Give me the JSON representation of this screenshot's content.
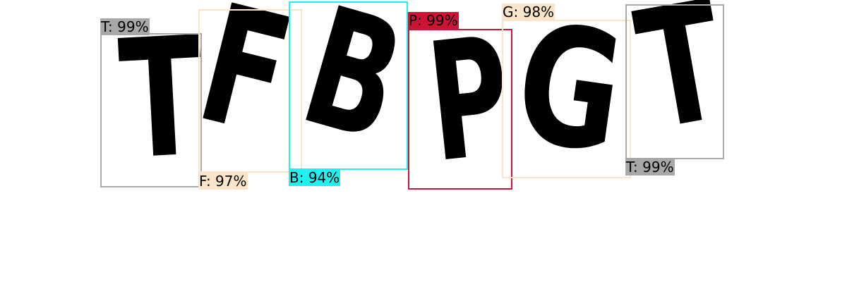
{
  "captcha_letters": [
    "T",
    "F",
    "B",
    "P",
    "G",
    "T"
  ],
  "detections": [
    {
      "label": "T: 99%",
      "char": "T",
      "confidence": 0.99,
      "color": "#a8a8a8"
    },
    {
      "label": "F: 97%",
      "char": "F",
      "confidence": 0.97,
      "color": "#fbe5c8"
    },
    {
      "label": "B: 94%",
      "char": "B",
      "confidence": 0.94,
      "color": "#1ff0f0"
    },
    {
      "label": "P: 99%",
      "char": "P",
      "confidence": 0.99,
      "color": "#cc1436"
    },
    {
      "label": "G: 98%",
      "char": "G",
      "confidence": 0.98,
      "color": "#fbe5c8"
    },
    {
      "label": "T: 99%",
      "char": "T",
      "confidence": 0.99,
      "color": "#a8a8a8"
    }
  ]
}
